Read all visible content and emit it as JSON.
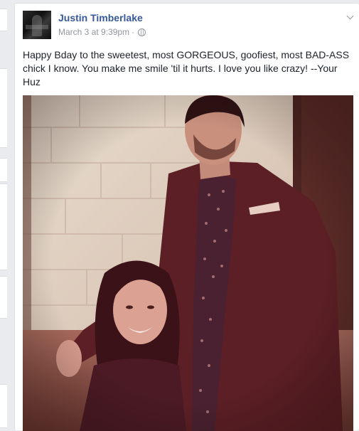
{
  "post": {
    "author": "Justin Timberlake",
    "timestamp": "March 3 at 9:39pm",
    "separator": "·",
    "privacy_icon": "globe-icon",
    "menu_icon": "chevron-down-icon",
    "message": "Happy Bday to the sweetest, most GORGEOUS, goofiest, most BAD-ASS chick I know. You make me smile 'til it hurts. I love you like crazy! --Your Huz",
    "photo_description_icon": "photo"
  },
  "colors": {
    "page_bg": "#e9ebee",
    "author_link": "#365899",
    "meta_text": "#90949c",
    "body_text": "#1d2129"
  }
}
